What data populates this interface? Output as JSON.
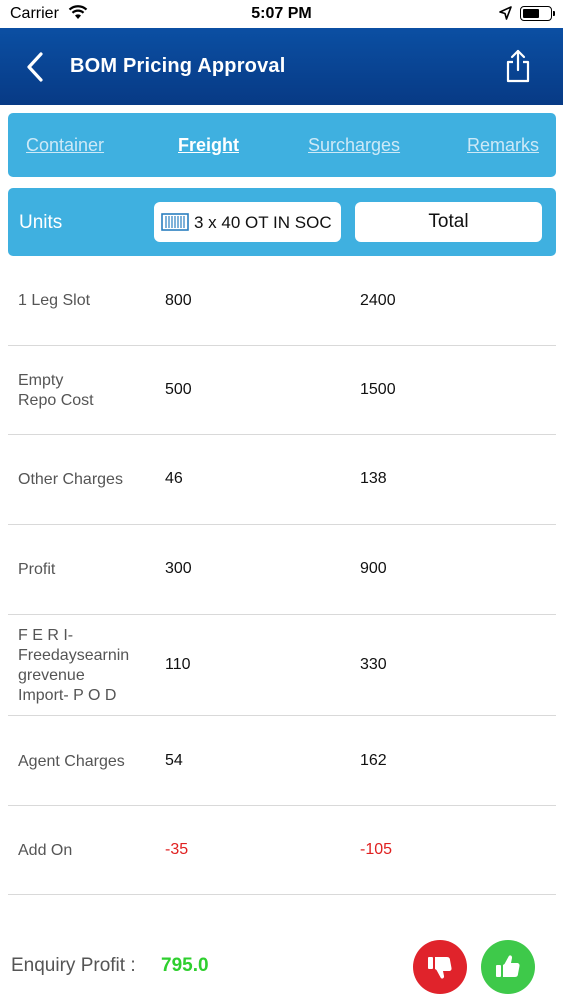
{
  "status_bar": {
    "carrier": "Carrier",
    "time": "5:07 PM"
  },
  "header": {
    "title": "BOM Pricing Approval"
  },
  "tabs": [
    {
      "label": "Container",
      "active": false
    },
    {
      "label": "Freight",
      "active": true
    },
    {
      "label": "Surcharges",
      "active": false
    },
    {
      "label": "Remarks",
      "active": false
    }
  ],
  "units_bar": {
    "label": "Units",
    "unit": "3 x 40 OT IN SOC",
    "total_label": "Total"
  },
  "rows": [
    {
      "label": "1 Leg Slot",
      "value": "800",
      "total": "2400"
    },
    {
      "label": "Empty\nRepo Cost",
      "value": "500",
      "total": "1500"
    },
    {
      "label": "Other Charges",
      "value": "46",
      "total": "138"
    },
    {
      "label": "Profit",
      "value": "300",
      "total": "900"
    },
    {
      "label": "F E R I-\nFreedaysearnin\ngrevenue\nImport- P O D",
      "value": "110",
      "total": "330"
    },
    {
      "label": "Agent Charges",
      "value": "54",
      "total": "162"
    },
    {
      "label": "Add On",
      "value": "-35",
      "total": "-105"
    }
  ],
  "footer": {
    "label": "Enquiry Profit :",
    "value": "795.0"
  },
  "colors": {
    "nav": "#073a85",
    "accent": "#3fb0e0",
    "negative": "#e02020",
    "profit": "#2fcf2f",
    "reject": "#e0232b",
    "approve": "#3ec94a"
  }
}
